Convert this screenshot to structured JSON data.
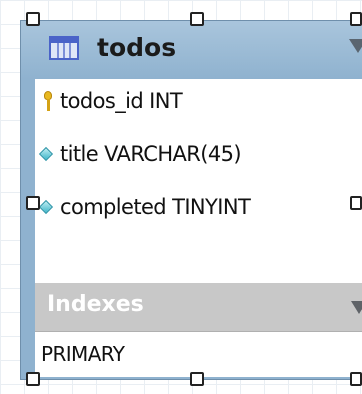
{
  "table": {
    "name": "todos",
    "header_color": "#8fb2cf",
    "columns": [
      {
        "label": "todos_id INT",
        "icon": "primary-key-icon"
      },
      {
        "label": "title VARCHAR(45)",
        "icon": "column-diamond-icon"
      },
      {
        "label": "completed TINYINT",
        "icon": "column-diamond-icon"
      }
    ],
    "indexes_label": "Indexes",
    "indexes": [
      "PRIMARY"
    ]
  },
  "icons": {
    "table": "table-icon",
    "collapse": "chevron-down-icon",
    "handle": "resize-handle-icon"
  }
}
